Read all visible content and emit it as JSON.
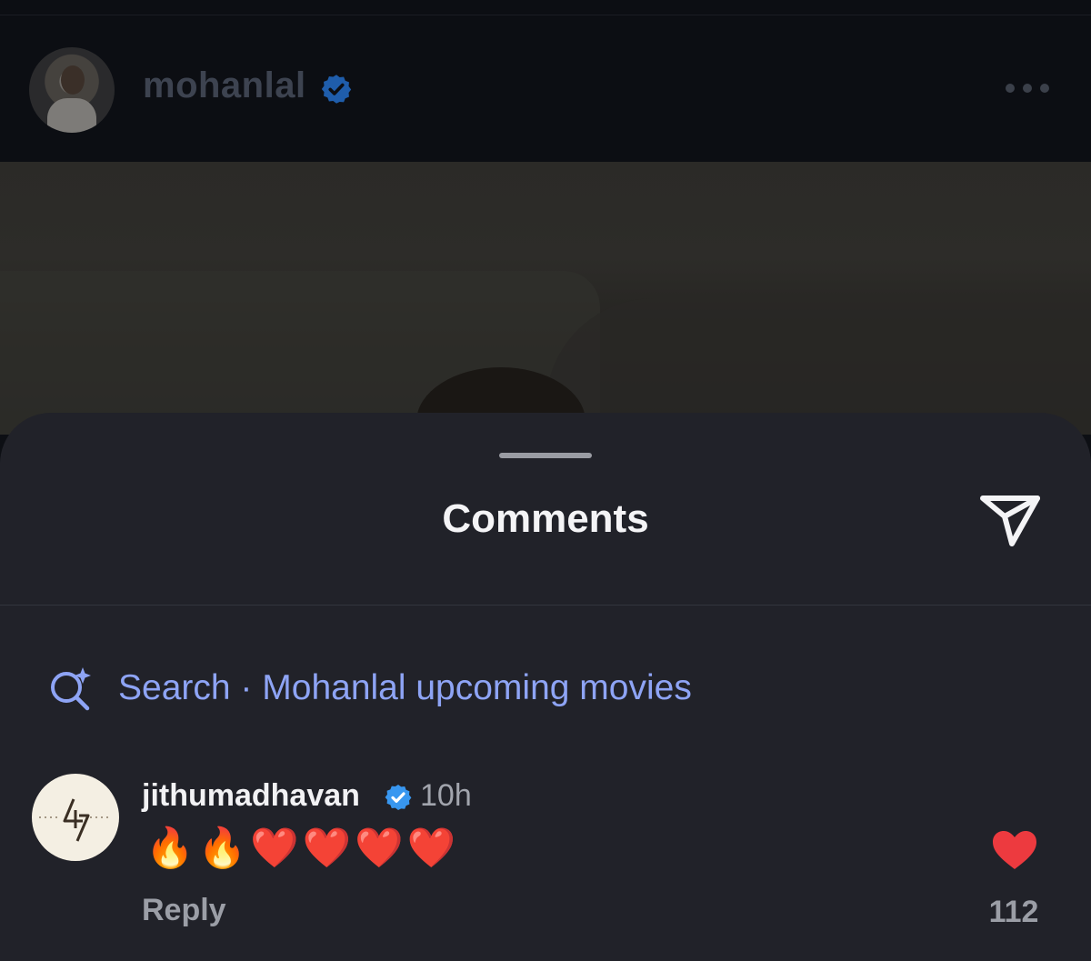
{
  "post_header": {
    "username": "mohanlal",
    "verified": true,
    "more_icon": "more-horizontal-icon"
  },
  "comments_sheet": {
    "title": "Comments",
    "share_icon": "send-icon",
    "search": {
      "icon": "ai-search-icon",
      "label": "Search",
      "separator": "·",
      "query": "Mohanlal upcoming movies"
    },
    "comments": [
      {
        "username": "jithumadhavan",
        "verified": true,
        "time": "10h",
        "text": "🔥🔥❤️❤️❤️❤️",
        "reply_label": "Reply",
        "liked": true,
        "likes": "112"
      }
    ]
  },
  "colors": {
    "accent_link": "#8ea4f5",
    "verified_badge": "#3897f0",
    "like_red": "#ed3a3f",
    "sheet_bg": "#212229"
  }
}
